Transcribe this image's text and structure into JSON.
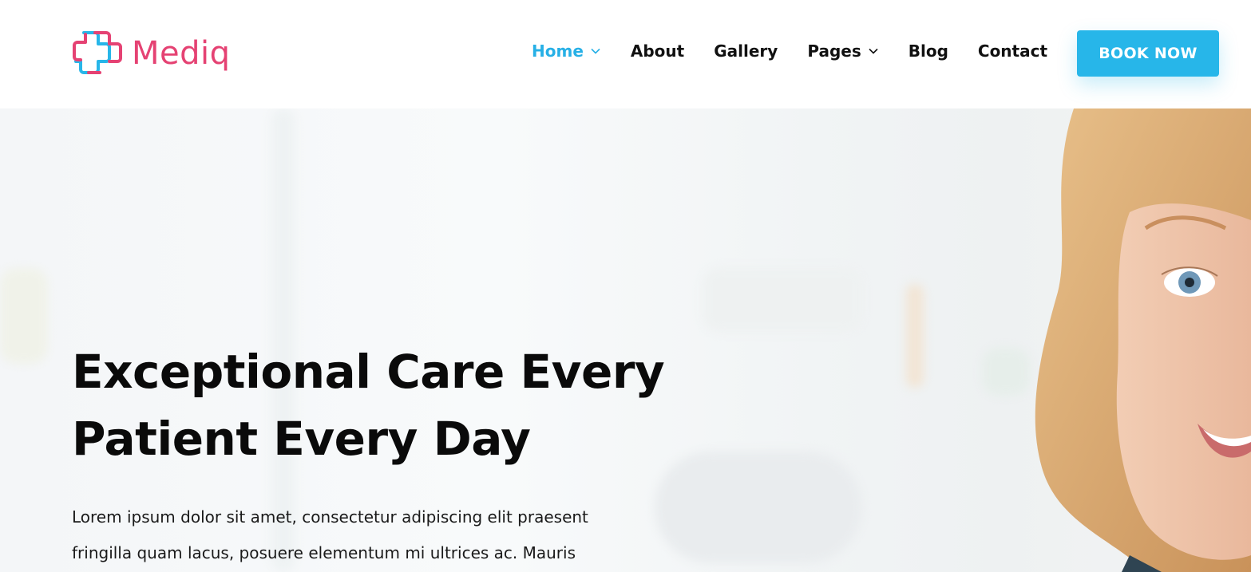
{
  "brand": {
    "name": "Mediq",
    "icon": "medical-cross-logo",
    "primary_color": "#27b6e9",
    "accent_color": "#e54273"
  },
  "nav": {
    "items": [
      {
        "label": "Home",
        "active": true,
        "has_dropdown": true
      },
      {
        "label": "About",
        "active": false,
        "has_dropdown": false
      },
      {
        "label": "Gallery",
        "active": false,
        "has_dropdown": false
      },
      {
        "label": "Pages",
        "active": false,
        "has_dropdown": true
      },
      {
        "label": "Blog",
        "active": false,
        "has_dropdown": false
      },
      {
        "label": "Contact",
        "active": false,
        "has_dropdown": false
      }
    ],
    "cta_label": "BOOK NOW"
  },
  "hero": {
    "title_lines": [
      "Exceptional Care Every",
      "Patient Every Day"
    ],
    "text_lines": [
      "Lorem ipsum dolor sit amet, consectetur adipiscing elit praesent",
      "fringilla quam lacus, posuere elementum mi ultrices ac. Mauris"
    ],
    "image": "smiling-woman-portrait"
  }
}
